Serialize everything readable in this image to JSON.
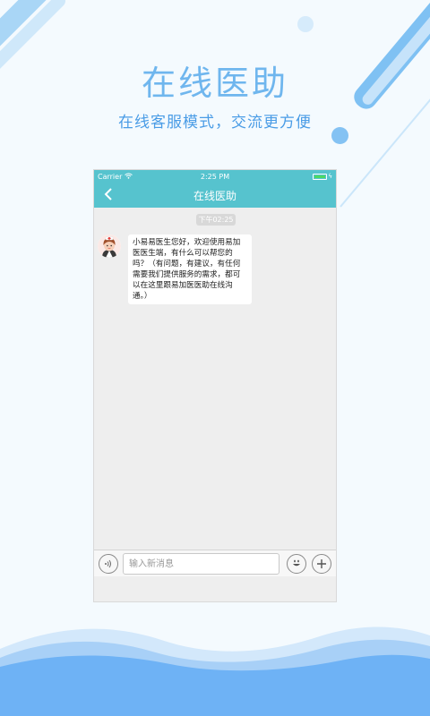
{
  "hero": {
    "title": "在线医助",
    "subtitle": "在线客服模式，交流更方便"
  },
  "phone": {
    "status_bar": {
      "carrier": "Carrier",
      "time": "2:25 PM",
      "battery_level": 1.0
    },
    "nav": {
      "title": "在线医助",
      "back_icon": "chevron-left-icon"
    },
    "chat": {
      "timestamp": "下午02:25",
      "messages": [
        {
          "sender_avatar": "nurse-avatar-icon",
          "text": "小易易医生您好，欢迎使用易加医医生端，有什么可以帮您的吗？（有问题，有建议，有任何需要我们提供服务的需求，都可以在这里跟易加医医助在线沟通。）"
        }
      ]
    },
    "input_bar": {
      "placeholder": "输入新消息",
      "voice_icon": "voice-icon",
      "emoji_icon": "emoji-icon",
      "plus_icon": "plus-icon"
    }
  },
  "colors": {
    "accent": "#56c3ce",
    "hero_title": "#6fb6ee",
    "hero_subtitle": "#4a9ce6",
    "wave": "#6eb2f5",
    "battery": "#4cd964"
  }
}
